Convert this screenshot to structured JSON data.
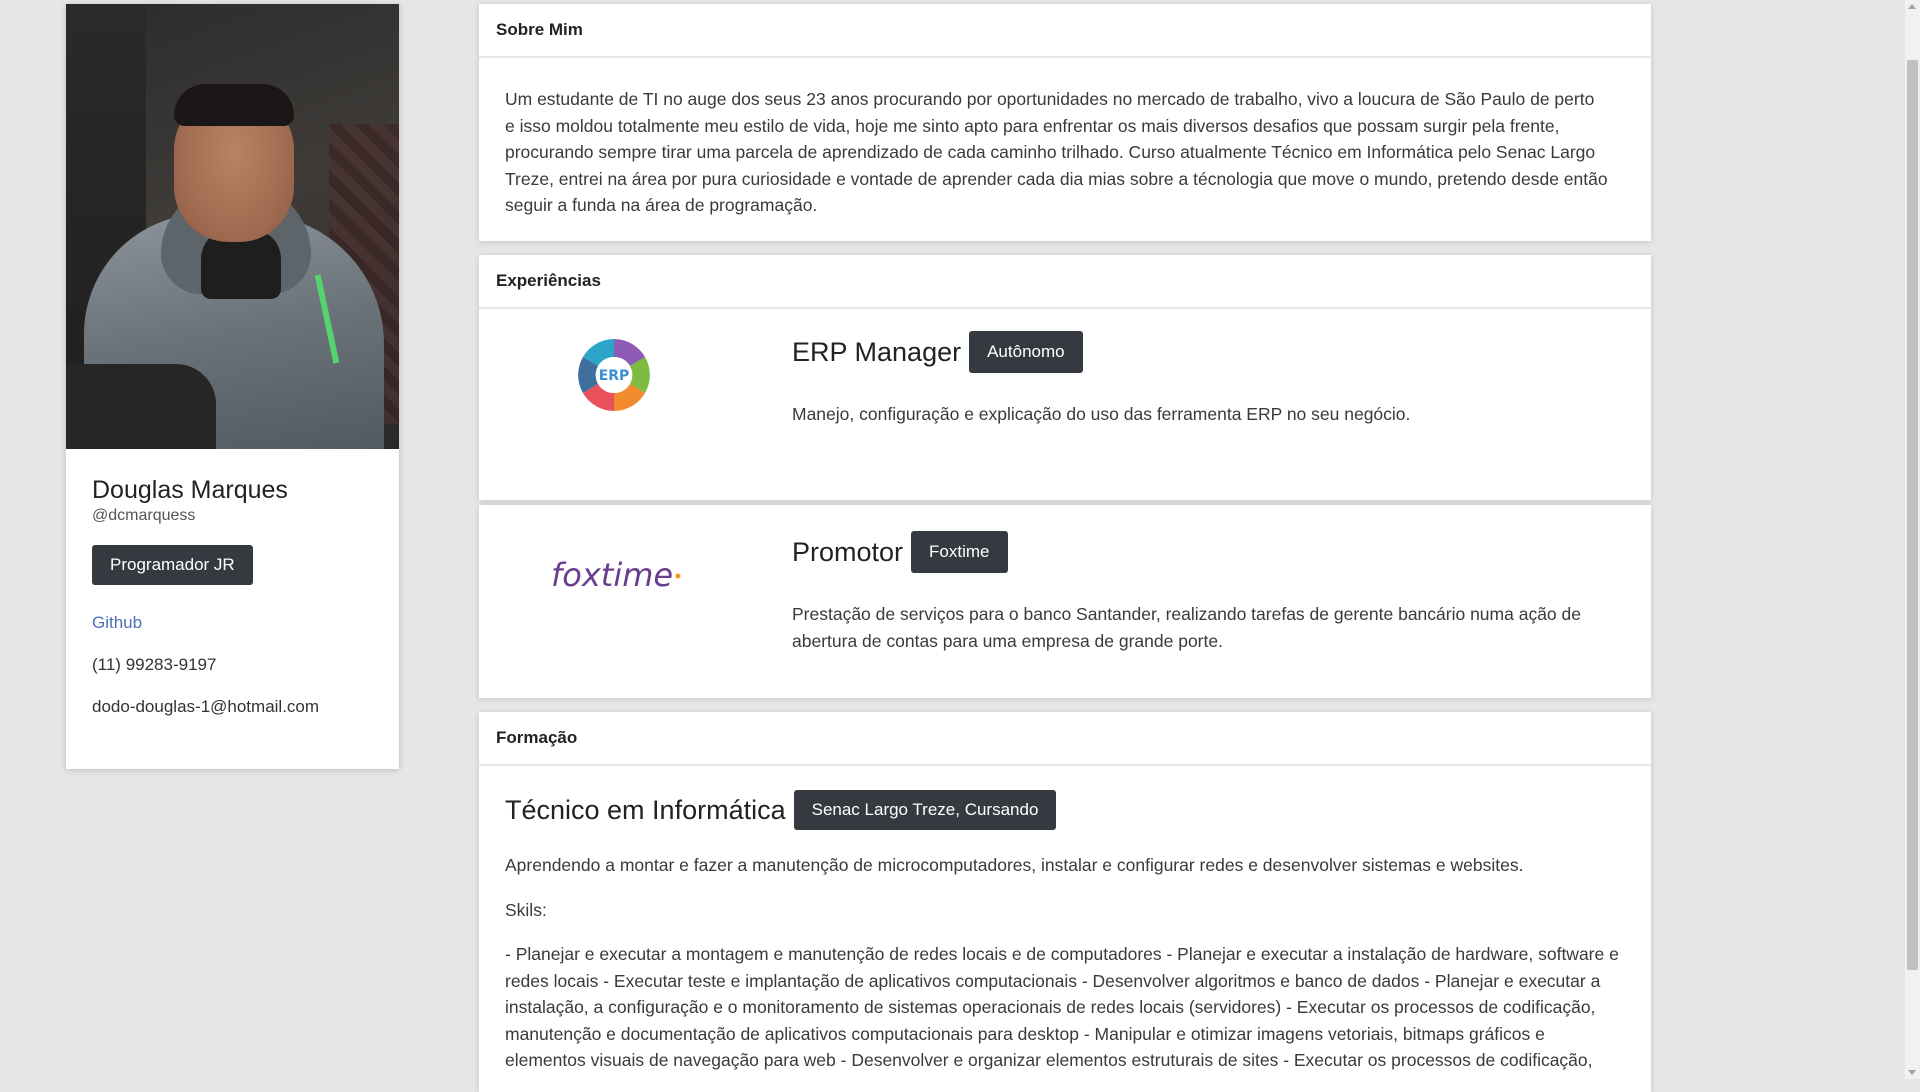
{
  "profile": {
    "name": "Douglas Marques",
    "handle": "@dcmarquess",
    "role": "Programador JR",
    "github_label": "Github",
    "phone": "(11) 99283-9197",
    "email": "dodo-douglas-1@hotmail.com"
  },
  "about": {
    "header": "Sobre Mim",
    "text": "Um estudante de TI no auge dos seus 23 anos procurando por oportunidades no mercado de trabalho, vivo a loucura de São Paulo de perto e isso moldou totalmente meu estilo de vida, hoje me sinto apto para enfrentar os mais diversos desafios que possam surgir pela frente, procurando sempre tirar uma parcela de aprendizado de cada caminho trilhado. Curso atualmente Técnico em Informática pelo Senac Largo Treze, entrei na área por pura curiosidade e vontade de aprender cada dia mias sobre a técnologia que move o mundo, pretendo desde então seguir a funda na área de programação."
  },
  "experiences": {
    "header": "Experiências",
    "items": [
      {
        "title": "ERP Manager",
        "badge": "Autônomo",
        "logo_text": "ERP",
        "description": "Manejo, configuração e explicação do uso das ferramenta ERP no seu negócio."
      },
      {
        "title": "Promotor",
        "badge": "Foxtime",
        "logo_text": "foxtime",
        "description": "Prestação de serviços para o banco Santander, realizando tarefas de gerente bancário numa ação de abertura de contas para uma empresa de grande porte."
      }
    ]
  },
  "education": {
    "header": "Formação",
    "title": "Técnico em Informática",
    "badge": "Senac Largo Treze, Cursando",
    "description": "Aprendendo a montar e fazer a manutenção de microcomputadores, instalar e configurar redes e desenvolver sistemas e websites.",
    "skills_label": "Skils:",
    "skills_text": "- Planejar e executar a montagem e manutenção de redes locais e de computadores - Planejar e executar a instalação de hardware, software e redes locais - Executar teste e implantação de aplicativos computacionais - Desenvolver algoritmos e banco de dados - Planejar e executar a instalação, a configuração e o monitoramento de sistemas operacionais de redes locais (servidores) - Executar os processos de codificação, manutenção e documentação de aplicativos computacionais para desktop - Manipular e otimizar imagens vetoriais, bitmaps gráficos e elementos visuais de navegação para web - Desenvolver e organizar elementos estruturais de sites - Executar os processos de codificação,"
  },
  "colors": {
    "page_bg": "#e6e6e6",
    "badge_bg": "#343a40",
    "link": "#4d6fb8",
    "foxtime_purple": "#6a3d8f",
    "foxtime_orange": "#f39a1e"
  }
}
